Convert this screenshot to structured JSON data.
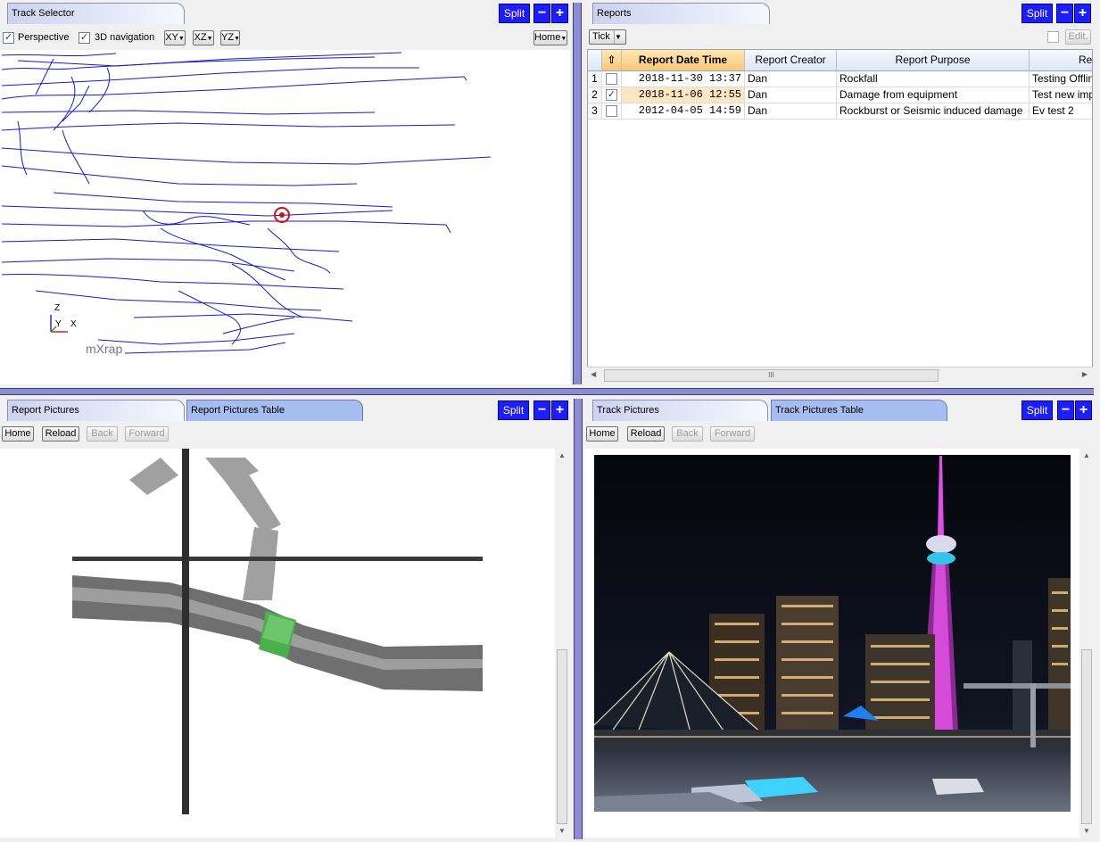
{
  "track_selector": {
    "tab": "Track Selector",
    "split": "Split",
    "minus": "−",
    "plus": "+",
    "perspective_label": "Perspective",
    "perspective_checked": "✓",
    "nav3d_label": "3D navigation",
    "nav3d_checked": "✓",
    "btn_xy": "XY",
    "btn_xz": "XZ",
    "btn_yz": "YZ",
    "btn_home": "Home",
    "axis_z": "Z",
    "axis_y": "Y",
    "axis_x": "X",
    "logo": "mXrap"
  },
  "reports": {
    "tab": "Reports",
    "split": "Split",
    "minus": "−",
    "plus": "+",
    "tick_dropdown": "Tick",
    "edit_button": "Edit.",
    "columns": [
      "Report Date Time",
      "Report Creator",
      "Report Purpose",
      "Rep"
    ],
    "rows": [
      {
        "num": "1",
        "checked": "",
        "date": "2018-11-30 13:37",
        "creator": "Dan",
        "purpose": "Rockfall",
        "rep": "Testing Offlin"
      },
      {
        "num": "2",
        "checked": "✓",
        "date": "2018-11-06 12:55",
        "creator": "Dan",
        "purpose": "Damage from equipment",
        "rep": "Test new imp"
      },
      {
        "num": "3",
        "checked": "",
        "date": "2012-04-05 14:59",
        "creator": "Dan",
        "purpose": "Rockburst or Seismic induced damage",
        "rep": "Ev test 2"
      }
    ],
    "scroll_grip": "III"
  },
  "report_pictures": {
    "tab1": "Report Pictures",
    "tab2": "Report Pictures Table",
    "split": "Split",
    "minus": "−",
    "plus": "+",
    "home": "Home",
    "reload": "Reload",
    "back": "Back",
    "forward": "Forward"
  },
  "track_pictures": {
    "tab1": "Track Pictures",
    "tab2": "Track Pictures Table",
    "split": "Split",
    "minus": "−",
    "plus": "+",
    "home": "Home",
    "reload": "Reload",
    "back": "Back",
    "forward": "Forward"
  },
  "colors": {
    "accent_blue": "#1d1dff",
    "splitter": "#8e8cd0",
    "track_line": "#1a1acc",
    "marker": "#d01010",
    "highlight_row": "#fde7c3",
    "tunnel_green": "#49b04a"
  }
}
